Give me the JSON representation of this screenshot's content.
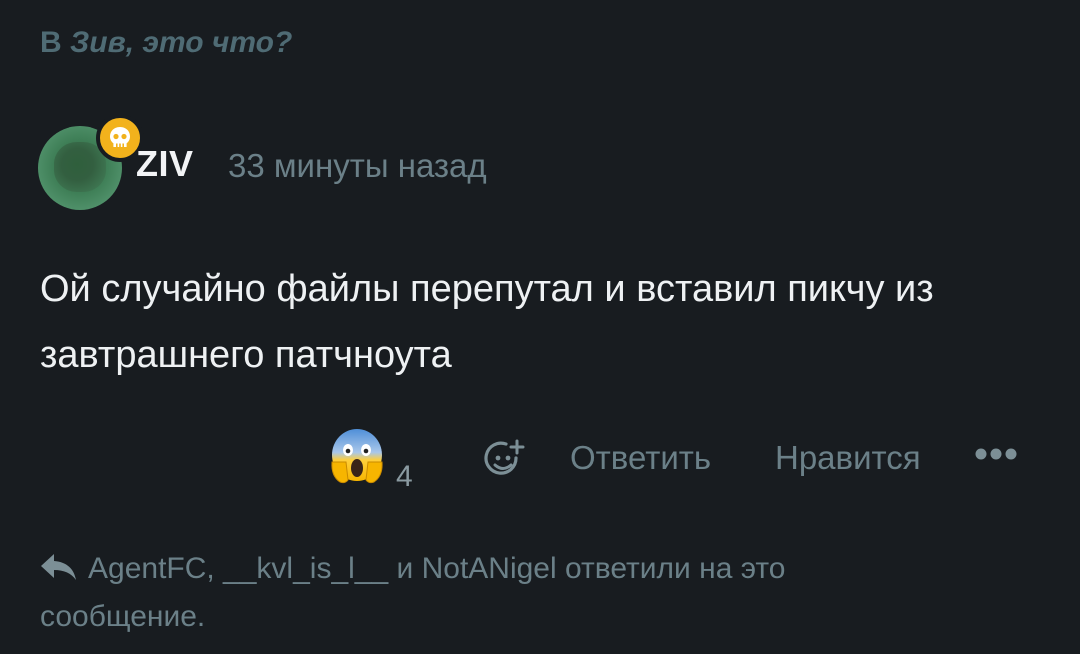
{
  "reply_context": {
    "prefix": "В",
    "thread_title": "Зив, это что?"
  },
  "post": {
    "author": "ZIV",
    "badge_icon": "skull-icon",
    "timestamp": "33 минуты назад",
    "text": "Ой случайно файлы перепутал и вставил пикчу из завтрашнего патчноута"
  },
  "actions": {
    "reaction": {
      "emoji": "😱",
      "icon": "screaming-face-icon",
      "count": "4"
    },
    "add_reaction_icon": "add-emoji-icon",
    "reply_label": "Ответить",
    "like_label": "Нравится",
    "more_icon": "more-dots-icon"
  },
  "replies_note": {
    "icon": "reply-arrow-icon",
    "text": "AgentFC, __kvl_is_l__ и NotANigel ответили на это сообщение."
  },
  "colors": {
    "background": "#181c20",
    "muted": "#6b8088",
    "badge": "#f2b21c",
    "context": "#4f6b74"
  }
}
